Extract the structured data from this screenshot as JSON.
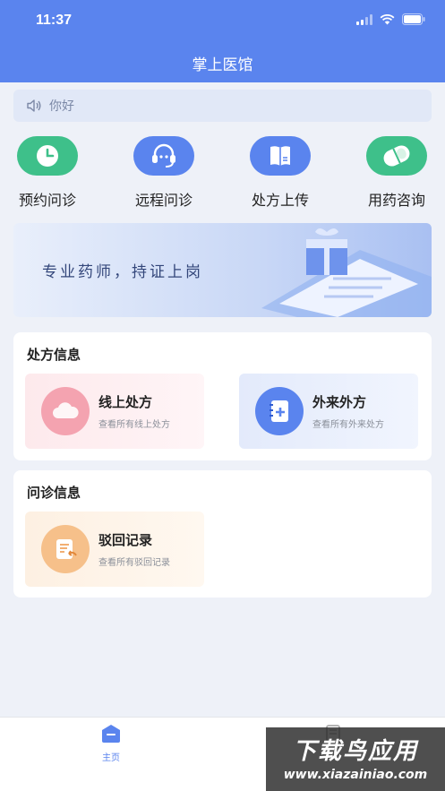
{
  "status_bar": {
    "time": "11:37"
  },
  "header": {
    "title": "掌上医馆"
  },
  "notice": {
    "text": "你好"
  },
  "quick_actions": [
    {
      "label": "预约问诊",
      "icon": "clock-icon",
      "color": "#3ec08a"
    },
    {
      "label": "远程问诊",
      "icon": "customer-service-icon",
      "color": "#5a84ee"
    },
    {
      "label": "处方上传",
      "icon": "book-icon",
      "color": "#5a84ee"
    },
    {
      "label": "用药咨询",
      "icon": "pill-icon",
      "color": "#3ec08a"
    }
  ],
  "banner": {
    "text": "专业药师，持证上岗"
  },
  "prescription_section": {
    "title": "处方信息",
    "items": [
      {
        "title": "线上处方",
        "subtitle": "查看所有线上处方",
        "icon": "cloud-icon"
      },
      {
        "title": "外来外方",
        "subtitle": "查看所有外来处方",
        "icon": "notebook-add-icon"
      }
    ]
  },
  "consult_section": {
    "title": "问诊信息",
    "items": [
      {
        "title": "驳回记录",
        "subtitle": "查看所有驳回记录",
        "icon": "reject-record-icon"
      }
    ]
  },
  "tabbar": {
    "tabs": [
      {
        "label": "主页",
        "active": true
      },
      {
        "label": "",
        "active": false
      }
    ]
  },
  "watermark": {
    "main": "下载鸟应用",
    "sub": "www.xiazainiao.com"
  },
  "colors": {
    "primary": "#5a84ee",
    "green": "#3ec08a",
    "background": "#eef1f8"
  }
}
